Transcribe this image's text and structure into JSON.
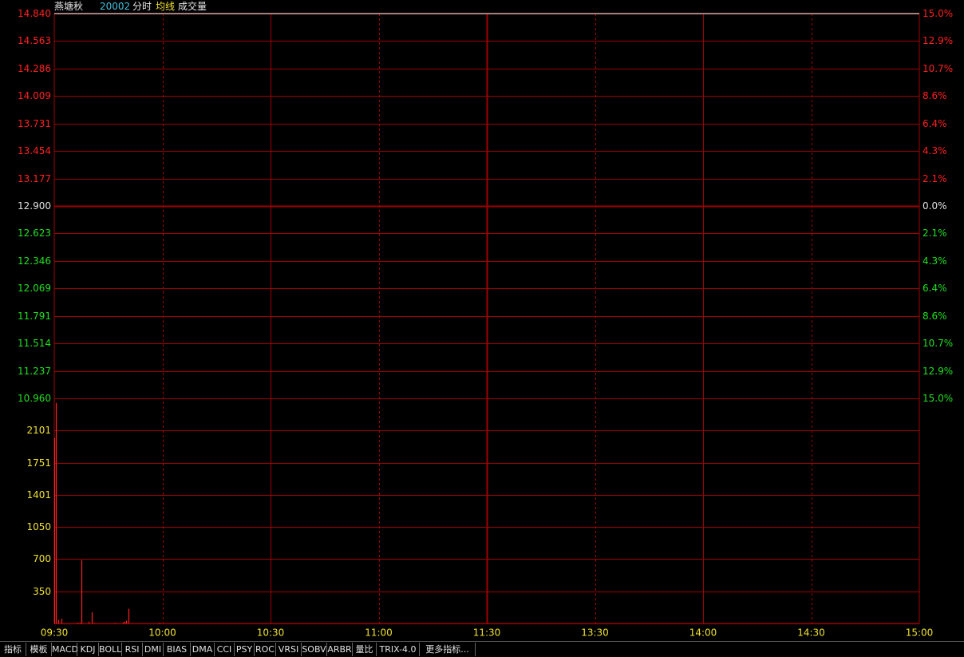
{
  "header": {
    "stock_name": "燕塘秋",
    "code": "20002",
    "mode": "分时",
    "avg_line": "均线",
    "volume": "成交量"
  },
  "colors": {
    "background": "#000000",
    "grid": "#a00000",
    "up": "#ff2020",
    "down": "#20e020",
    "neutral": "#e0e0e0",
    "volume_axis": "#f0e030",
    "time_axis": "#f0e030"
  },
  "chart_data": [
    {
      "type": "line",
      "name": "intraday-price",
      "ylim": [
        10.96,
        14.84
      ],
      "reference_price": 12.9,
      "y_ticks_left": [
        "14.840",
        "14.563",
        "14.286",
        "14.009",
        "13.731",
        "13.454",
        "13.177",
        "12.900",
        "12.623",
        "12.346",
        "12.069",
        "11.791",
        "11.514",
        "11.237",
        "10.960"
      ],
      "y_tick_values": [
        14.84,
        14.563,
        14.286,
        14.009,
        13.731,
        13.454,
        13.177,
        12.9,
        12.623,
        12.346,
        12.069,
        11.791,
        11.514,
        11.237,
        10.96
      ],
      "y_ticks_right": [
        "15.0%",
        "12.9%",
        "10.7%",
        "8.6%",
        "6.4%",
        "4.3%",
        "2.1%",
        "0.0%",
        "2.1%",
        "4.3%",
        "6.4%",
        "8.6%",
        "10.7%",
        "12.9%",
        "15.0%"
      ],
      "price_series": {
        "x": [
          "09:30",
          "15:00"
        ],
        "y": [
          14.84,
          14.84
        ]
      }
    },
    {
      "type": "bar",
      "name": "volume",
      "ylim": [
        0,
        2451
      ],
      "y_ticks": [
        "2101",
        "1751",
        "1401",
        "1050",
        "700",
        "350"
      ],
      "y_tick_values": [
        2101,
        1751,
        1401,
        1050,
        700,
        350
      ],
      "x_minutes": [
        0,
        1,
        2,
        4,
        13,
        14,
        15,
        19,
        21,
        22,
        33,
        34,
        38,
        39,
        40,
        41,
        58,
        59
      ],
      "values": [
        2020,
        2401,
        40,
        50,
        10,
        8,
        690,
        20,
        120,
        6,
        5,
        5,
        12,
        20,
        30,
        160,
        8,
        5
      ]
    }
  ],
  "time_axis": {
    "labels": [
      "09:30",
      "10:00",
      "10:30",
      "11:00",
      "11:30",
      "13:30",
      "14:00",
      "14:30",
      "15:00"
    ],
    "label_minutes": [
      0,
      30,
      60,
      90,
      120,
      150,
      180,
      210,
      240
    ],
    "total_minutes": 240
  },
  "bottom_tabs": [
    "指标",
    "模板",
    "MACD",
    "KDJ",
    "BOLL",
    "RSI",
    "DMI",
    "BIAS",
    "DMA",
    "CCI",
    "PSY",
    "ROC",
    "VRSI",
    "SOBV",
    "ARBR",
    "量比",
    "TRIX-4.0",
    "更多指标..."
  ],
  "bottom_tab_widths": [
    33,
    32,
    32,
    27,
    29,
    26,
    26,
    34,
    30,
    25,
    25,
    27,
    32,
    32,
    32,
    30,
    54,
    70
  ]
}
